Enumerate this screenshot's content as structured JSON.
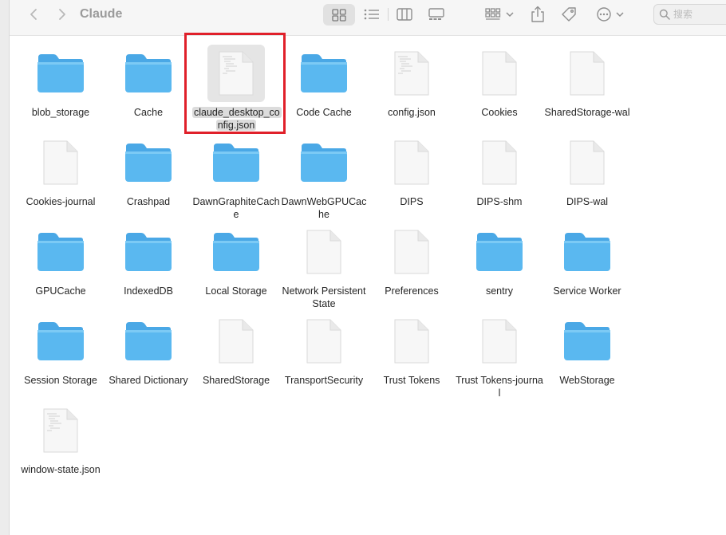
{
  "window": {
    "title": "Claude"
  },
  "search": {
    "placeholder": "搜索"
  },
  "highlight_color": "#e0202a",
  "folder_color": "#5ab8f0",
  "items": [
    {
      "label": "blob_storage",
      "type": "folder"
    },
    {
      "label": "Cache",
      "type": "folder"
    },
    {
      "label": "claude_desktop_config.json",
      "type": "doc-text",
      "selected": true
    },
    {
      "label": "Code Cache",
      "type": "folder"
    },
    {
      "label": "config.json",
      "type": "doc-text"
    },
    {
      "label": "Cookies",
      "type": "doc"
    },
    {
      "label": "SharedStorage-wal",
      "type": "doc"
    },
    {
      "label": "Cookies-journal",
      "type": "doc"
    },
    {
      "label": "Crashpad",
      "type": "folder"
    },
    {
      "label": "DawnGraphiteCache",
      "type": "folder"
    },
    {
      "label": "DawnWebGPUCache",
      "type": "folder"
    },
    {
      "label": "DIPS",
      "type": "doc"
    },
    {
      "label": "DIPS-shm",
      "type": "doc"
    },
    {
      "label": "DIPS-wal",
      "type": "doc"
    },
    {
      "label": "GPUCache",
      "type": "folder"
    },
    {
      "label": "IndexedDB",
      "type": "folder"
    },
    {
      "label": "Local Storage",
      "type": "folder"
    },
    {
      "label": "Network Persistent State",
      "type": "doc"
    },
    {
      "label": "Preferences",
      "type": "doc"
    },
    {
      "label": "sentry",
      "type": "folder"
    },
    {
      "label": "Service Worker",
      "type": "folder"
    },
    {
      "label": "Session Storage",
      "type": "folder"
    },
    {
      "label": "Shared Dictionary",
      "type": "folder"
    },
    {
      "label": "SharedStorage",
      "type": "doc"
    },
    {
      "label": "TransportSecurity",
      "type": "doc"
    },
    {
      "label": "Trust Tokens",
      "type": "doc"
    },
    {
      "label": "Trust Tokens-journal",
      "type": "doc"
    },
    {
      "label": "WebStorage",
      "type": "folder"
    },
    {
      "label": "window-state.json",
      "type": "doc-text"
    }
  ]
}
